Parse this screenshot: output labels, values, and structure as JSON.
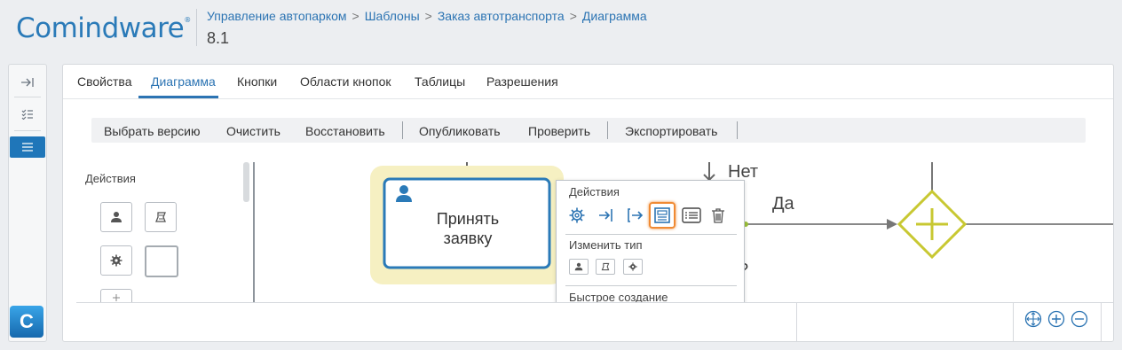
{
  "header": {
    "logo_text": "Comindware",
    "logo_mark": "®",
    "breadcrumbs": [
      "Управление автопарком",
      "Шаблоны",
      "Заказ автотранспорта",
      "Диаграмма"
    ],
    "breadcrumb_separator": ">",
    "version": "8.1"
  },
  "rail": {
    "items": [
      {
        "icon": "collapse-arrow-icon",
        "glyph": "→|"
      },
      {
        "icon": "checklist-icon",
        "glyph": "☰"
      },
      {
        "icon": "list-icon",
        "glyph": "☰",
        "active": true
      }
    ],
    "logo_letter": "C"
  },
  "tabs": [
    {
      "label": "Свойства",
      "active": false
    },
    {
      "label": "Диаграмма",
      "active": true
    },
    {
      "label": "Кнопки",
      "active": false
    },
    {
      "label": "Области кнопок",
      "active": false
    },
    {
      "label": "Таблицы",
      "active": false
    },
    {
      "label": "Разрешения",
      "active": false
    }
  ],
  "toolbar": {
    "select_version": "Выбрать версию",
    "clear": "Очистить",
    "restore": "Восстановить",
    "publish": "Опубликовать",
    "check": "Проверить",
    "export": "Экспортировать"
  },
  "palette": {
    "title": "Действия"
  },
  "diagram": {
    "task_label_line1": "Принять",
    "task_label_line2": "заявку",
    "label_no": "Нет",
    "label_yes": "Да",
    "label_partial": "а?",
    "gateway_color": "#c8c832",
    "task_border_color": "#2a7ab8",
    "task_halo_color": "#f6f0c2"
  },
  "popup": {
    "actions_title": "Действия",
    "change_type_title": "Изменить тип",
    "quick_create_title": "Быстрое создание",
    "highlight_color": "#f08a33"
  },
  "zoom": {
    "fit_icon": "fit-icon",
    "zoom_in_icon": "zoom-in-icon",
    "zoom_out_icon": "zoom-out-icon"
  },
  "accent_color": "#2c74b3"
}
